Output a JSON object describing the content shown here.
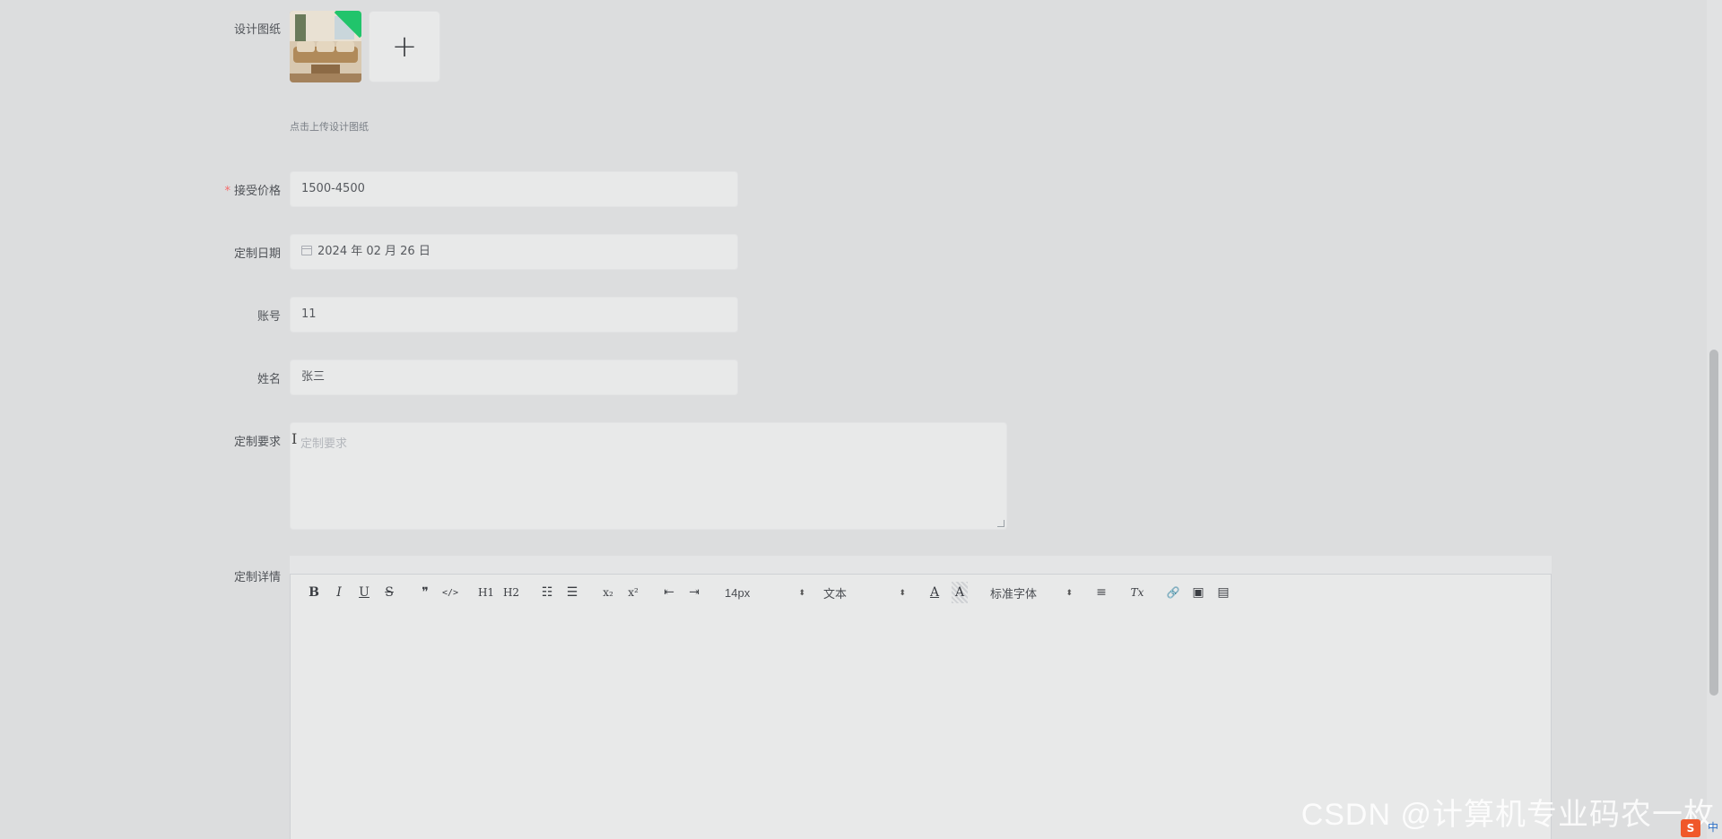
{
  "form": {
    "design": {
      "label": "设计图纸",
      "upload_tip": "点击上传设计图纸",
      "add_icon": "+"
    },
    "price": {
      "required_mark": "*",
      "label": "接受价格",
      "value": "1500-4500"
    },
    "date": {
      "label": "定制日期",
      "value": "2024 年 02 月 26 日"
    },
    "account": {
      "label": "账号",
      "value": "11"
    },
    "name": {
      "label": "姓名",
      "value": "张三"
    },
    "requirement": {
      "label": "定制要求",
      "placeholder": "定制要求"
    },
    "detail": {
      "label": "定制详情"
    }
  },
  "editor": {
    "toolbar": {
      "bold": "B",
      "italic": "I",
      "underline": "U",
      "strike": "S",
      "blockquote": "❞",
      "code": "</>",
      "h1": "H1",
      "h2": "H2",
      "ordered_list": "☷",
      "bullet_list": "☰",
      "subscript": "x₂",
      "superscript": "x²",
      "outdent": "⇤",
      "indent": "⇥",
      "size": "14px",
      "header": "文本",
      "color": "A",
      "background": "A",
      "font": "标准字体",
      "align": "≡",
      "clean": "Tx",
      "link": "🔗",
      "image": "▣",
      "video": "▤"
    }
  },
  "watermark": "CSDN @计算机专业码农一枚",
  "tray": {
    "ime": "中"
  }
}
